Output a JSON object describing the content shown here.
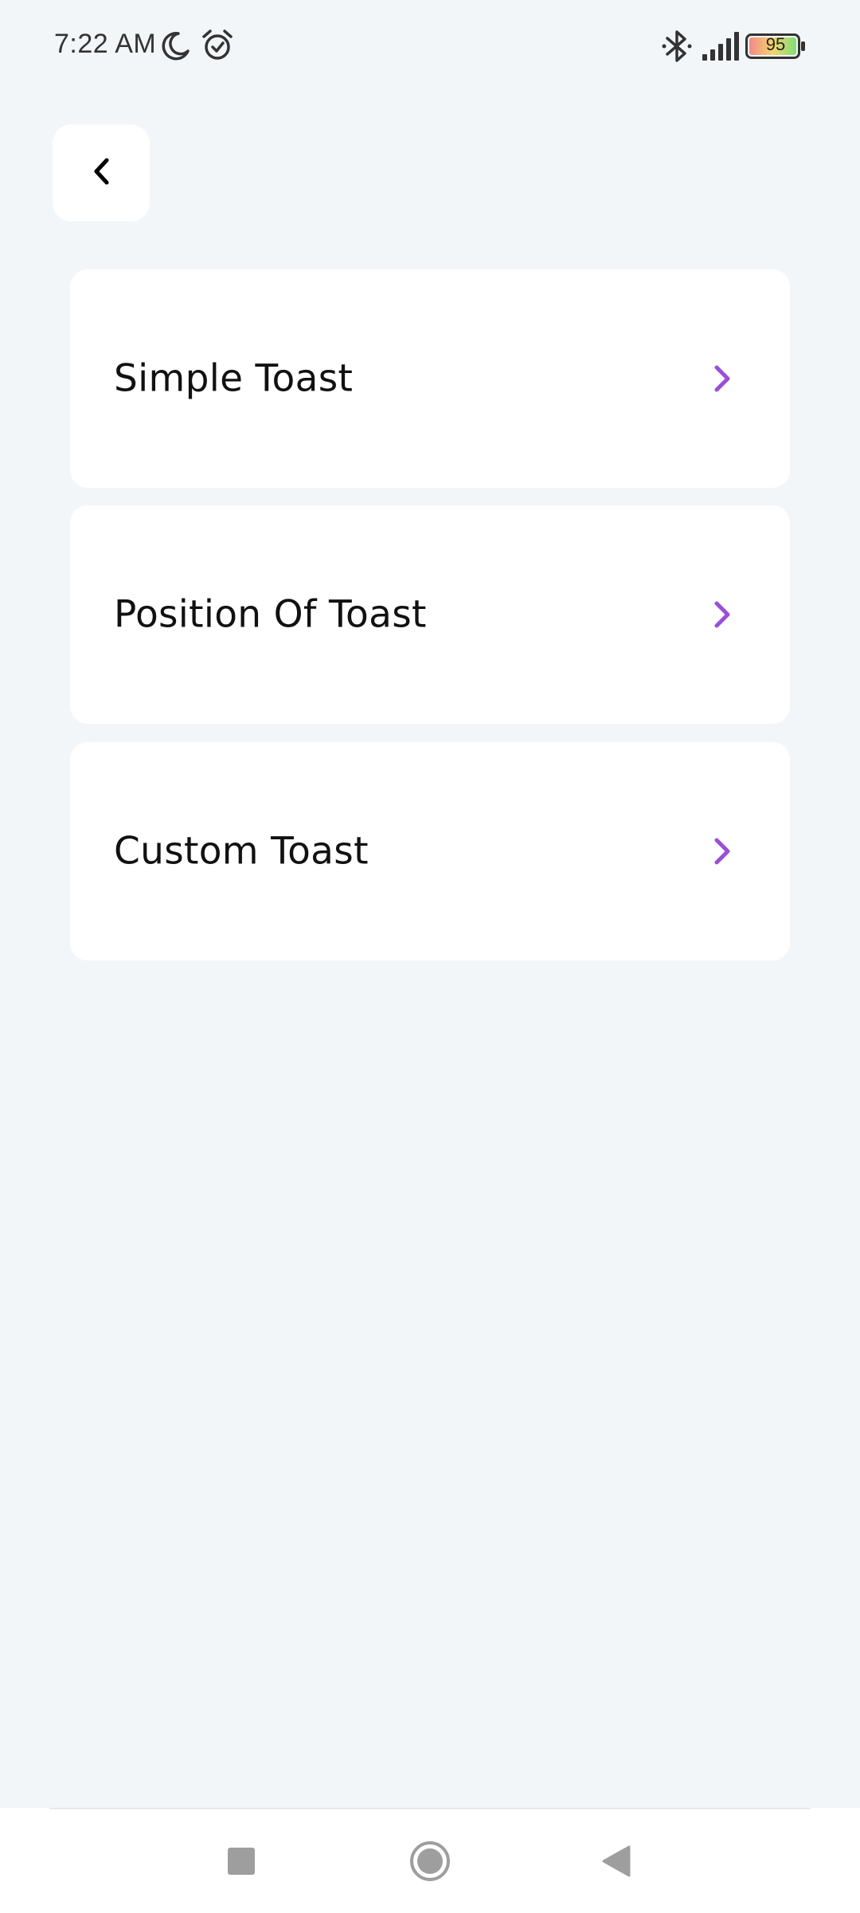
{
  "status_bar": {
    "time": "7:22 AM",
    "battery_level": "95",
    "icons": [
      "moon-icon",
      "alarm-icon",
      "bluetooth-icon",
      "signal-icon",
      "battery-icon"
    ]
  },
  "header": {
    "back_icon": "chevron-left-icon"
  },
  "menu": {
    "items": [
      {
        "label": "Simple Toast",
        "icon": "chevron-right-icon"
      },
      {
        "label": "Position Of Toast",
        "icon": "chevron-right-icon"
      },
      {
        "label": "Custom Toast",
        "icon": "chevron-right-icon"
      }
    ],
    "accent_color": "#9a4fd8"
  },
  "nav_bar": {
    "buttons": [
      "recents-button",
      "home-button",
      "back-button"
    ]
  },
  "colors": {
    "background": "#f3f6f8",
    "card": "#ffffff",
    "text": "#111111"
  }
}
